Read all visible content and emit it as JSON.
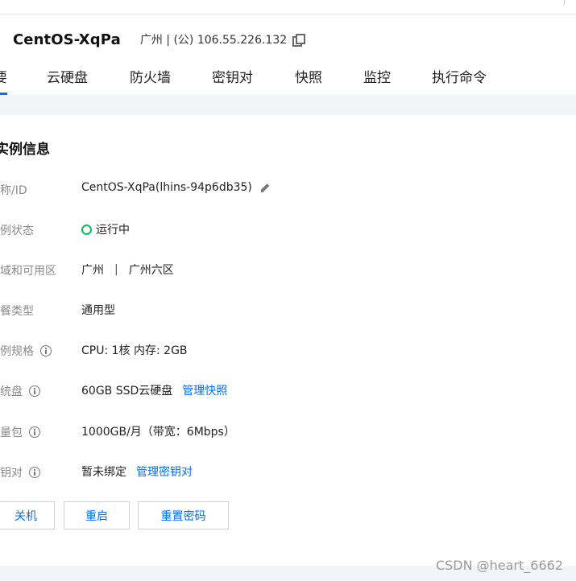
{
  "instance": {
    "title": "CentOS-XqPa",
    "meta": "广州 | (公) 106.55.226.132"
  },
  "tabs": [
    {
      "label": "要"
    },
    {
      "label": "云硬盘"
    },
    {
      "label": "防火墙"
    },
    {
      "label": "密钥对"
    },
    {
      "label": "快照"
    },
    {
      "label": "监控"
    },
    {
      "label": "执行命令"
    }
  ],
  "section": {
    "title": "实例信息"
  },
  "rows": [
    {
      "label": "称/ID",
      "value": "CentOS-XqPa(lhins-94p6db35)"
    },
    {
      "label": "例状态",
      "value": "运行中"
    },
    {
      "label": "域和可用区",
      "region": "广州",
      "separator": "|",
      "zone": "广州六区"
    },
    {
      "label": "餐类型",
      "value": "通用型"
    },
    {
      "label": "例规格",
      "value": "CPU: 1核 内存: 2GB"
    },
    {
      "label": "统盘",
      "value": "60GB SSD云硬盘",
      "link": "管理快照"
    },
    {
      "label": "量包",
      "value": "1000GB/月（带宽：6Mbps）"
    },
    {
      "label": "钥对",
      "value": "暂未绑定",
      "link": "管理密钥对"
    }
  ],
  "buttons": {
    "shutdown": "关机",
    "restart": "重启",
    "reset_password": "重置密码"
  },
  "watermark": "CSDN @heart_6662",
  "colors": {
    "accent": "#006eff",
    "status_running": "#0abf5b"
  }
}
